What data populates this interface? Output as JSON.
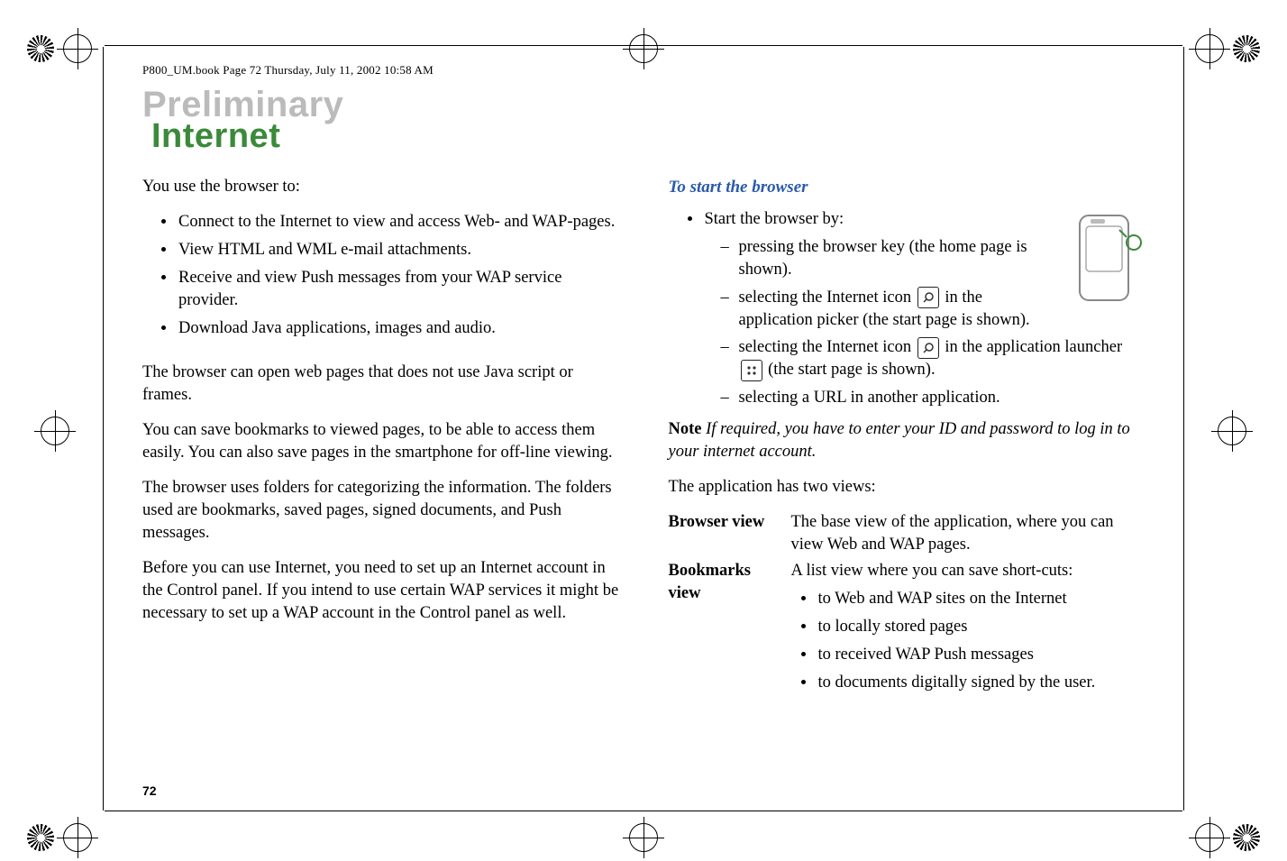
{
  "header_line": "P800_UM.book  Page 72  Thursday, July 11, 2002  10:58 AM",
  "watermark": "Preliminary",
  "title": "Internet",
  "page_number": "72",
  "left_col": {
    "intro": "You use the browser to:",
    "bullets": [
      "Connect to the Internet to view and access Web- and WAP-pages.",
      "View HTML and WML e-mail attachments.",
      "Receive and view Push messages from your WAP service provider.",
      "Download Java applications, images and audio."
    ],
    "p1": "The browser can open web pages that does not use Java script or frames.",
    "p2": "You can save bookmarks to viewed pages, to be able to access them easily. You can also save pages in the smartphone for off-line viewing.",
    "p3": "The browser uses folders for categorizing the information. The folders used are bookmarks, saved pages, signed documents, and Push messages.",
    "p4": "Before you can use Internet, you need to set up an Internet account in the Control panel. If you intend to use certain WAP services it might be necessary to set up a WAP account in the Control panel as well."
  },
  "right_col": {
    "subhead": "To start the browser",
    "start_intro": "Start the browser by:",
    "start_items": {
      "a_prefix": "pressing the browser key (the home page is shown).",
      "b_prefix": "selecting the Internet icon ",
      "b_suffix": " in the application picker (the start page is shown).",
      "c_prefix": "selecting the Internet icon ",
      "c_mid": " in the application launcher ",
      "c_suffix": " (the start page is shown).",
      "d": "selecting a URL in another application."
    },
    "note_label": "Note",
    "note_body": " If required, you have to enter your ID and password to log in to your internet account.",
    "two_views": "The application has two views:",
    "views": {
      "browser_label": "Browser view",
      "browser_text": "The base view of the application, where you can view Web and WAP pages.",
      "bookmarks_label": "Bookmarks view",
      "bookmarks_intro": "A list view where you can save short-cuts:",
      "bookmarks_bullets": [
        "to Web and WAP sites on the Internet",
        "to locally stored pages",
        "to received WAP Push messages",
        "to documents digitally signed by the user."
      ]
    }
  }
}
